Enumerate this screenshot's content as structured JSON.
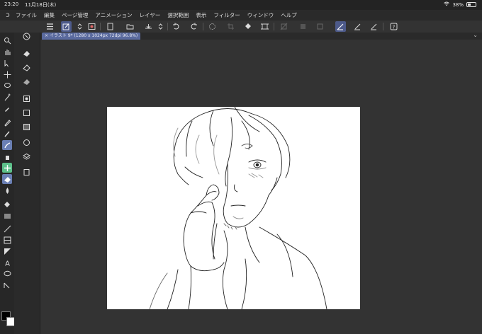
{
  "status": {
    "time": "23:20",
    "date": "11月18日(木)",
    "battery": "38%",
    "battery_level": 0.38
  },
  "menu": {
    "items": [
      "ファイル",
      "編集",
      "ページ管理",
      "アニメーション",
      "レイヤー",
      "選択範囲",
      "表示",
      "フィルター",
      "ウィンドウ",
      "ヘルプ"
    ]
  },
  "document": {
    "tab_title": "イラスト 9* (1280 x 1024px 72dpi 96.8%)"
  },
  "colors": {
    "main": "#000000",
    "sub": "#ffffff",
    "accent": "#5a6a9e",
    "active_tool": "#6a7fb4"
  }
}
